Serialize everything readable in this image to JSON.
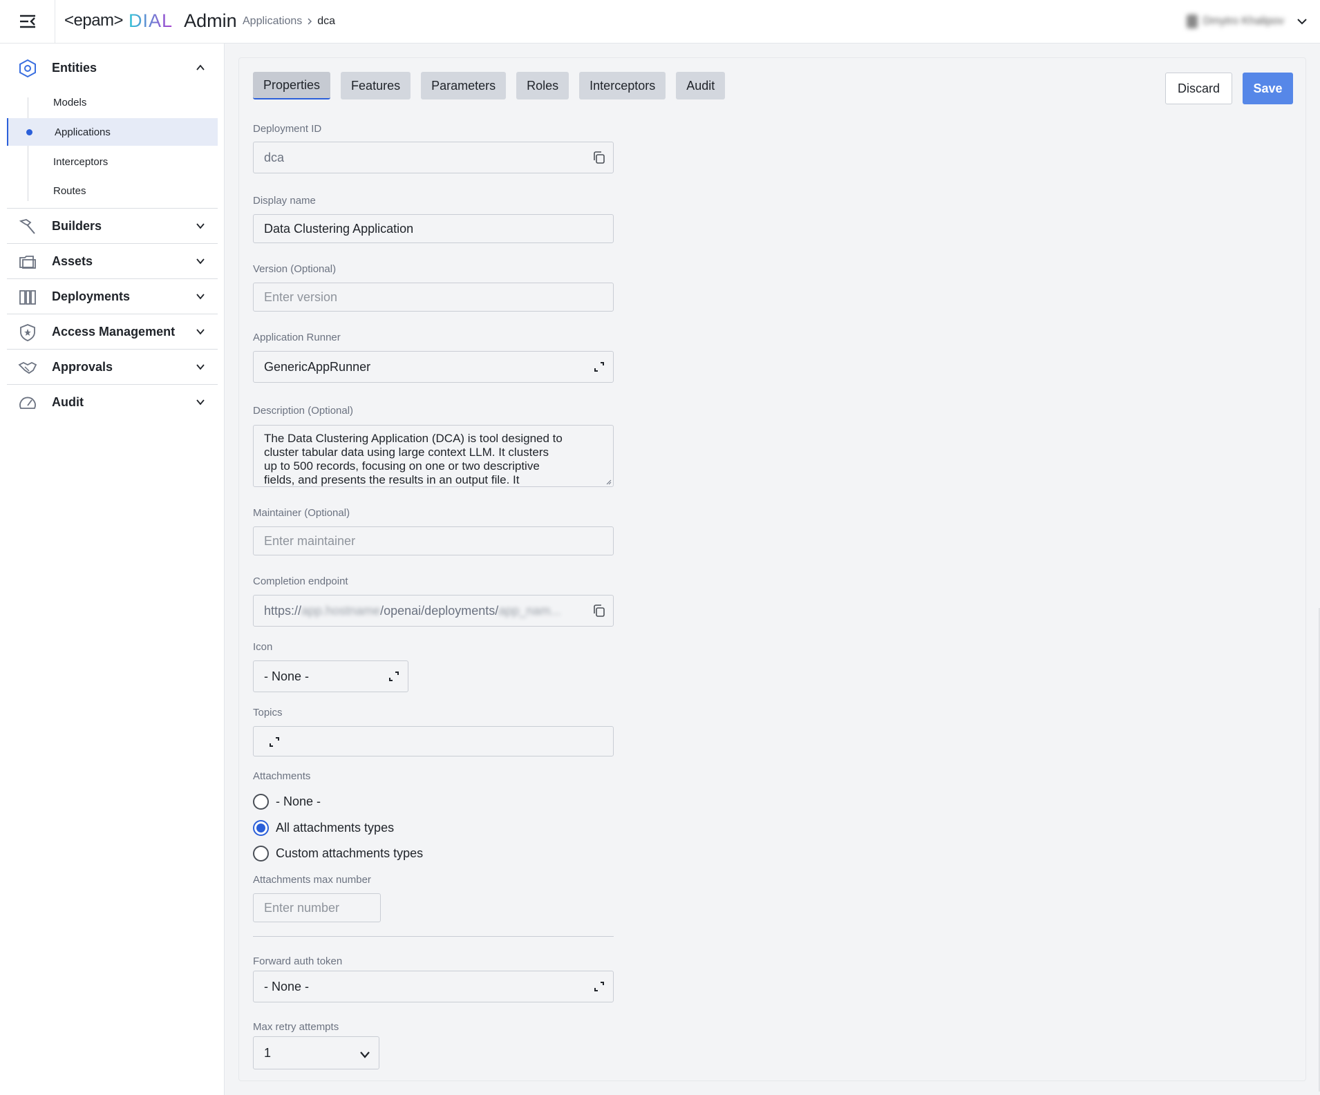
{
  "header": {
    "logo": {
      "brand": "<epam>",
      "product": "DIAL",
      "suffix": "Admin"
    },
    "breadcrumb": {
      "parent": "Applications",
      "separator": ">",
      "current": "dca"
    },
    "user": {
      "name": "Dmytro Khalipov"
    }
  },
  "sidebar": {
    "entities": {
      "label": "Entities",
      "icon": "hexagon-icon",
      "expanded": true,
      "items": [
        {
          "label": "Models"
        },
        {
          "label": "Applications",
          "active": true
        },
        {
          "label": "Interceptors"
        },
        {
          "label": "Routes"
        }
      ]
    },
    "sections": [
      {
        "label": "Builders",
        "icon": "hammer-icon"
      },
      {
        "label": "Assets",
        "icon": "folder-icon"
      },
      {
        "label": "Deployments",
        "icon": "deployments-icon"
      },
      {
        "label": "Access Management",
        "icon": "shield-star-icon"
      },
      {
        "label": "Approvals",
        "icon": "handshake-icon"
      },
      {
        "label": "Audit",
        "icon": "gauge-icon"
      }
    ]
  },
  "tabs": [
    {
      "label": "Properties",
      "active": true
    },
    {
      "label": "Features"
    },
    {
      "label": "Parameters"
    },
    {
      "label": "Roles"
    },
    {
      "label": "Interceptors"
    },
    {
      "label": "Audit"
    }
  ],
  "actions": {
    "discard": "Discard",
    "save": "Save"
  },
  "form": {
    "deployment_id": {
      "label": "Deployment ID",
      "value": "dca"
    },
    "display_name": {
      "label": "Display name",
      "value": "Data Clustering Application"
    },
    "version": {
      "label": "Version (Optional)",
      "placeholder": "Enter version"
    },
    "application_runner": {
      "label": "Application Runner",
      "value": "GenericAppRunner"
    },
    "description": {
      "label": "Description (Optional)",
      "lines": [
        "The Data Clustering Application (DCA) is tool designed to",
        "cluster tabular data using large context LLM. It clusters",
        "up to 500 records, focusing on one or two descriptive",
        "fields, and presents the results in an output file. It"
      ]
    },
    "maintainer": {
      "label": "Maintainer (Optional)",
      "placeholder": "Enter maintainer"
    },
    "completion_endpoint": {
      "label": "Completion endpoint",
      "prefix": "https://",
      "host": "app.hostname",
      "middle": "/openai/deployments/",
      "suffix": "app_nam..."
    },
    "icon": {
      "label": "Icon",
      "value": "- None -"
    },
    "topics": {
      "label": "Topics"
    },
    "attachments": {
      "label": "Attachments",
      "options": [
        {
          "label": "- None -",
          "checked": false
        },
        {
          "label": "All attachments types",
          "checked": true
        },
        {
          "label": "Custom attachments types",
          "checked": false
        }
      ]
    },
    "attachments_max": {
      "label": "Attachments max number",
      "placeholder": "Enter number"
    },
    "forward_auth_token": {
      "label": "Forward auth token",
      "value": "- None -"
    },
    "max_retry": {
      "label": "Max retry attempts",
      "value": "1"
    }
  },
  "colors": {
    "accent": "#2b5fd9",
    "save_button": "#5687e8",
    "dial_gradient_start": "#2ec4d6",
    "dial_gradient_end": "#a83fd0"
  }
}
